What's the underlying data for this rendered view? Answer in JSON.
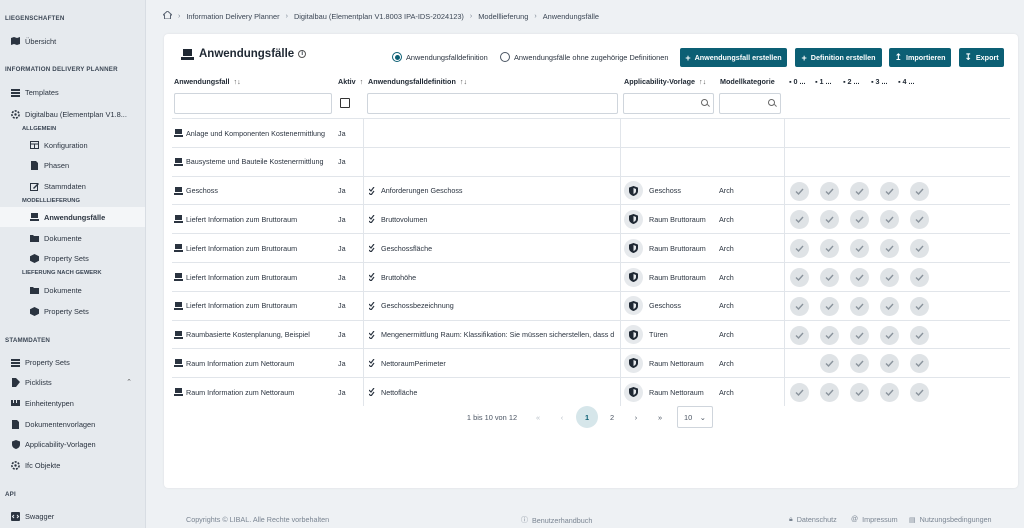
{
  "sidebar": {
    "sections": [
      "LIEGENSCHAFTEN",
      "INFORMATION DELIVERY PLANNER",
      "STAMMDATEN",
      "API"
    ],
    "subsections": [
      "ALLGEMEIN",
      "MODELLLIEFERUNG",
      "LIEFERUNG NACH GEWERK"
    ],
    "items": [
      {
        "label": "Übersicht",
        "icon": "map-icon"
      },
      {
        "label": "Templates",
        "icon": "stack-icon"
      },
      {
        "label": "Digitalbau (Elementplan V1.8...",
        "icon": "gear-icon"
      },
      {
        "label": "Konfiguration",
        "icon": "table-icon"
      },
      {
        "label": "Phasen",
        "icon": "document-icon"
      },
      {
        "label": "Stammdaten",
        "icon": "edit-icon"
      },
      {
        "label": "Anwendungsfälle",
        "icon": "laptop-icon"
      },
      {
        "label": "Dokumente",
        "icon": "folder-icon"
      },
      {
        "label": "Property Sets",
        "icon": "cube-icon"
      },
      {
        "label": "Dokumente",
        "icon": "folder-icon"
      },
      {
        "label": "Property Sets",
        "icon": "cube-icon"
      },
      {
        "label": "Property Sets",
        "icon": "stack-icon"
      },
      {
        "label": "Picklists",
        "icon": "list-icon"
      },
      {
        "label": "Einheitentypen",
        "icon": "ruler-icon"
      },
      {
        "label": "Dokumentenvorlagen",
        "icon": "document-icon"
      },
      {
        "label": "Applicability-Vorlagen",
        "icon": "shield-icon"
      },
      {
        "label": "Ifc Objekte",
        "icon": "settings-icon"
      },
      {
        "label": "Swagger",
        "icon": "code-icon"
      }
    ]
  },
  "breadcrumb": [
    "Information Delivery Planner",
    "Digitalbau (Elementplan V1.8003 IPA-IDS-2024123)",
    "Modelllieferung",
    "Anwendungsfälle"
  ],
  "page": {
    "title": "Anwendungsfälle",
    "radio_1": "Anwendungsfalldefinition",
    "radio_2": "Anwendungsfälle ohne zugehörige Definitionen",
    "btn_create_usecase": "Anwendungsfall erstellen",
    "btn_create_definition": "Definition erstellen",
    "btn_import": "Importieren",
    "btn_export": "Export"
  },
  "table": {
    "columns": [
      "Anwendungsfall",
      "Aktiv",
      "Anwendungsfalldefinition",
      "Applicability-Vorlage",
      "Modellkategorie",
      "0 ...",
      "1 ...",
      "2 ...",
      "3 ...",
      "4 ..."
    ],
    "rows": [
      {
        "usecase": "Anlage und Komponenten Kostenermittlung",
        "active": "Ja",
        "definition": "",
        "applicability": "",
        "category": "",
        "checks": [
          false,
          false,
          false,
          false,
          false
        ]
      },
      {
        "usecase": "Bausysteme und Bauteile Kostenermittlung",
        "active": "Ja",
        "definition": "",
        "applicability": "",
        "category": "",
        "checks": [
          false,
          false,
          false,
          false,
          false
        ]
      },
      {
        "usecase": "Geschoss",
        "active": "Ja",
        "definition": "Anforderungen Geschoss",
        "applicability": "Geschoss",
        "category": "Arch",
        "checks": [
          true,
          true,
          true,
          true,
          true
        ]
      },
      {
        "usecase": "Liefert Information zum Bruttoraum",
        "active": "Ja",
        "definition": "Bruttovolumen",
        "applicability": "Raum Bruttoraum",
        "category": "Arch",
        "checks": [
          true,
          true,
          true,
          true,
          true
        ]
      },
      {
        "usecase": "Liefert Information zum Bruttoraum",
        "active": "Ja",
        "definition": "Geschossfläche",
        "applicability": "Raum Bruttoraum",
        "category": "Arch",
        "checks": [
          true,
          true,
          true,
          true,
          true
        ]
      },
      {
        "usecase": "Liefert Information zum Bruttoraum",
        "active": "Ja",
        "definition": "Bruttohöhe",
        "applicability": "Raum Bruttoraum",
        "category": "Arch",
        "checks": [
          true,
          true,
          true,
          true,
          true
        ]
      },
      {
        "usecase": "Liefert Information zum Bruttoraum",
        "active": "Ja",
        "definition": "Geschossbezeichnung",
        "applicability": "Geschoss",
        "category": "Arch",
        "checks": [
          true,
          true,
          true,
          true,
          true
        ]
      },
      {
        "usecase": "Raumbasierte Kostenplanung, Beispiel",
        "active": "Ja",
        "definition": "Mengenermittlung Raum: Klassifikation: Sie müssen sicherstellen, dass d",
        "applicability": "Türen",
        "category": "Arch",
        "checks": [
          true,
          true,
          true,
          true,
          true
        ]
      },
      {
        "usecase": "Raum Information zum Nettoraum",
        "active": "Ja",
        "definition": "NettoraumPerimeter",
        "applicability": "Raum Nettoraum",
        "category": "Arch",
        "checks": [
          false,
          true,
          true,
          true,
          true
        ]
      },
      {
        "usecase": "Raum Information zum Nettoraum",
        "active": "Ja",
        "definition": "Nettofläche",
        "applicability": "Raum Nettoraum",
        "category": "Arch",
        "checks": [
          true,
          true,
          true,
          true,
          true
        ]
      }
    ]
  },
  "pagination": {
    "summary": "1 bis 10 von 12",
    "first": "«",
    "prev": "‹",
    "page_1": "1",
    "page_2": "2",
    "next": "›",
    "last": "»",
    "page_size": "10"
  },
  "footer": {
    "copyright": "Copyrights © LIBAL. Alle Rechte vorbehalten",
    "handbook": "Benutzerhandbuch",
    "privacy": "Datenschutz",
    "imprint": "Impressum",
    "terms": "Nutzungsbedingungen"
  },
  "colors": {
    "accent": "#0c5f74",
    "sidebar_bg": "#e6eaee",
    "page_bg": "#eef1f4"
  }
}
